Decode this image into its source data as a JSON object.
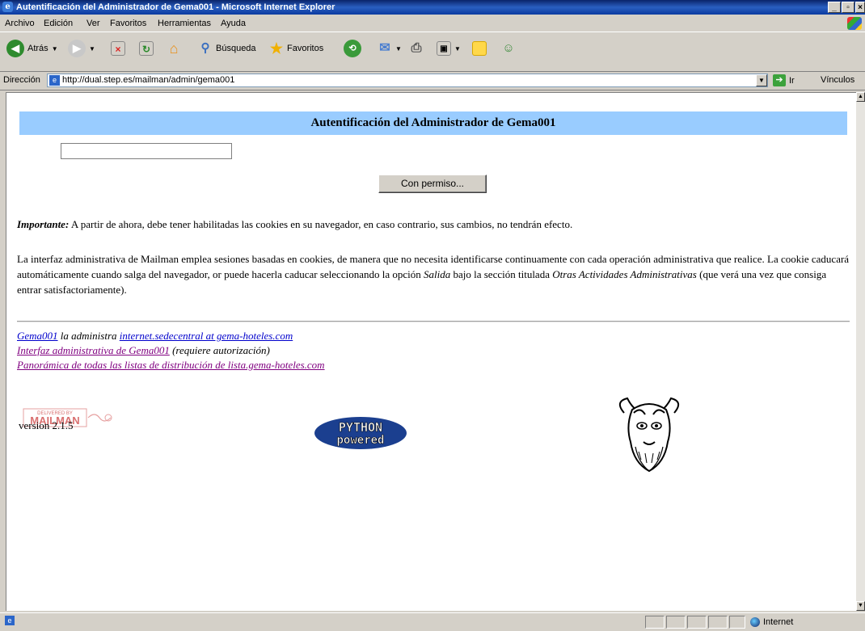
{
  "window": {
    "title": "Autentificación del Administrador de Gema001 - Microsoft Internet Explorer",
    "icon": "ie-icon"
  },
  "menu": {
    "items": [
      {
        "label": "Archivo"
      },
      {
        "label": "Edición"
      },
      {
        "label": "Ver"
      },
      {
        "label": "Favoritos"
      },
      {
        "label": "Herramientas"
      },
      {
        "label": "Ayuda"
      }
    ]
  },
  "toolbar": {
    "back_label": "Atrás",
    "search_label": "Búsqueda",
    "favorites_label": "Favoritos"
  },
  "address": {
    "label": "Dirección",
    "url": "http://dual.step.es/mailman/admin/gema001",
    "go_label": "Ir",
    "links_label": "Vínculos"
  },
  "page": {
    "heading": "Autentificación del Administrador de Gema001",
    "password_value": "",
    "submit_label": "Con permiso...",
    "important_label": "Importante:",
    "important_text": " A partir de ahora, debe tener habilitadas las cookies en su navegador, en caso contrario, sus cambios, no tendrán efecto.",
    "info_part1": "La interfaz administrativa de Mailman emplea sesiones basadas en cookies, de manera que no necesita identificarse continuamente con cada operación administrativa que realice. La cookie caducará automáticamente cuando salga del navegador, or puede hacerla caducar seleccionando la opción ",
    "info_salida": "Salida",
    "info_part2": " bajo la sección titulada ",
    "info_section": "Otras Actividades Administrativas",
    "info_part3": " (que verá una vez que consiga entrar satisfactoriamente).",
    "footer": {
      "list_link": "Gema001",
      "administered_by": " la administra ",
      "admin_email": "internet.sedecentral at gema-hoteles.com",
      "admin_iface_link": "Interfaz administrativa de Gema001",
      "admin_iface_note": " (requiere autorización)",
      "overview_link": "Panorámica de todas las listas de distribución de lista.gema-hoteles.com"
    },
    "logos": {
      "mailman_line1": "DELIVERED BY",
      "mailman_line2": "MAILMAN",
      "version": "version 2.1.5",
      "python_line1": "PYTHON",
      "python_line2": "powered"
    }
  },
  "statusbar": {
    "zone": "Internet"
  }
}
